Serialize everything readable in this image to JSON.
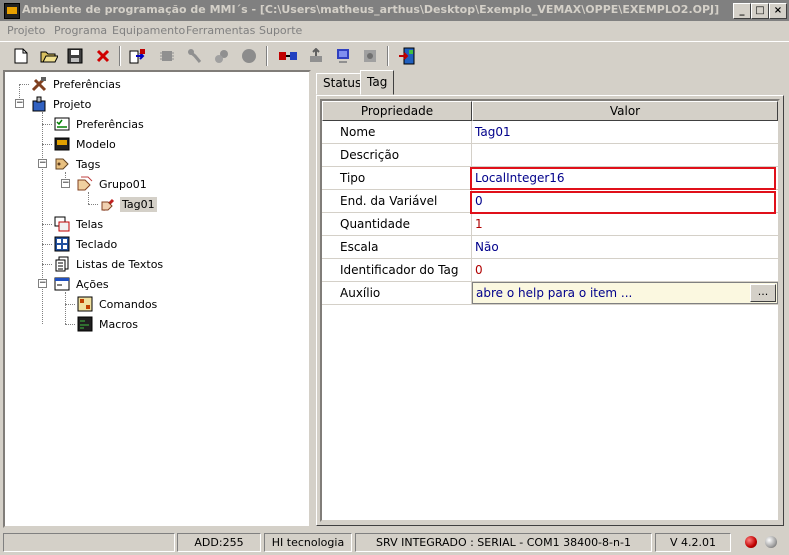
{
  "window": {
    "title": "Ambiente de programação de MMI´s - [C:\\Users\\matheus_arthus\\Desktop\\Exemplo_VEMAX\\OPPE\\EXEMPLO2.OPJ]",
    "controls": {
      "minimize": "_",
      "maximize": "□",
      "close": "×"
    }
  },
  "menu": [
    "Projeto",
    "Programa",
    "Equipamento",
    "Ferramentas",
    "Suporte"
  ],
  "toolbar": [
    "new-icon",
    "open-icon",
    "save-icon",
    "delete-icon",
    "compile-icon",
    "chip-icon",
    "tool-icon",
    "gears-icon",
    "circle-icon",
    "connect-icon",
    "upload-icon",
    "download-icon",
    "settings-icon",
    "exit-icon"
  ],
  "tree": {
    "preferencias_root": "Preferências",
    "projeto": "Projeto",
    "preferencias": "Preferências",
    "modelo": "Modelo",
    "tags": "Tags",
    "grupo01": "Grupo01",
    "tag01": "Tag01",
    "telas": "Telas",
    "teclado": "Teclado",
    "listas": "Listas de Textos",
    "acoes": "Ações",
    "comandos": "Comandos",
    "macros": "Macros"
  },
  "tabs": {
    "status": "Status",
    "tag": "Tag"
  },
  "grid": {
    "col_property": "Propriedade",
    "col_value": "Valor",
    "rows": [
      {
        "prop": "Nome",
        "value": "Tag01"
      },
      {
        "prop": "Descrição",
        "value": ""
      },
      {
        "prop": "Tipo",
        "value": "LocalInteger16"
      },
      {
        "prop": "End. da Variável",
        "value": "0"
      },
      {
        "prop": "Quantidade",
        "value": "1"
      },
      {
        "prop": "Escala",
        "value": "Não"
      },
      {
        "prop": "Identificador do Tag",
        "value": "0"
      },
      {
        "prop": "Auxílio",
        "value": "abre o help para o item ..."
      }
    ],
    "ellipsis": "..."
  },
  "status": {
    "add": "ADD:255",
    "company": "HI tecnologia",
    "server": "SRV INTEGRADO : SERIAL - COM1 38400-8-n-1",
    "version": "V 4.2.01"
  },
  "colors": {
    "highlight": "#e0101a",
    "value_text": "#00008b",
    "red_value": "#b00000",
    "help_bg": "#fbf8e0"
  }
}
